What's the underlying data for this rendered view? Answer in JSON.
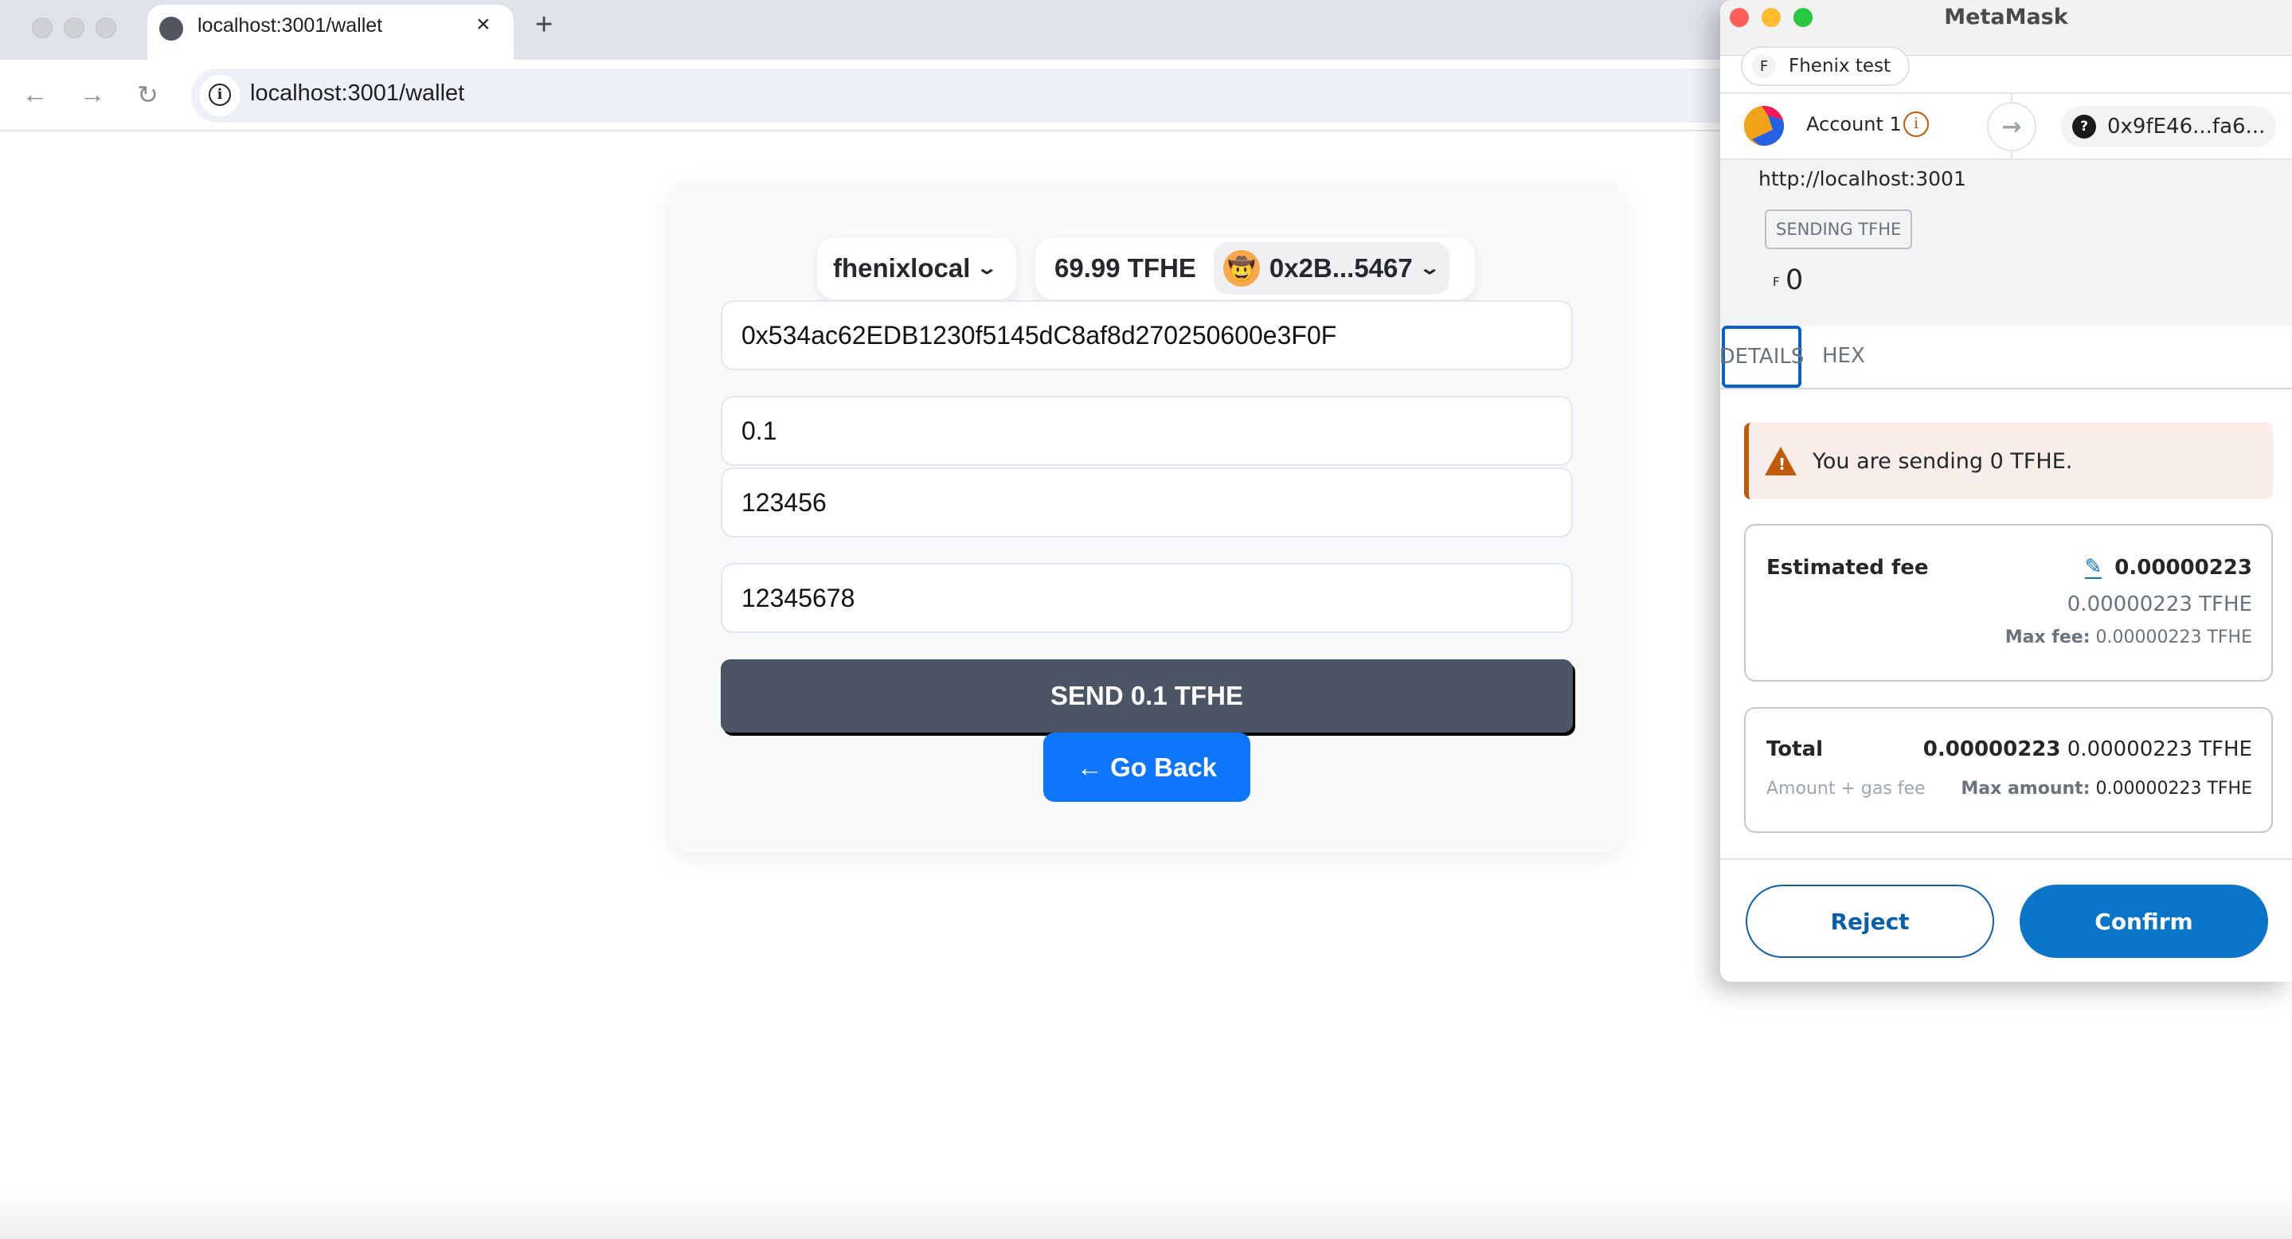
{
  "browser": {
    "tab_title": "localhost:3001/wallet",
    "tab_close_icon": "close-icon",
    "new_tab_icon": "plus-icon",
    "address_bar_url": "localhost:3001/wallet",
    "nav": {
      "back_icon": "←",
      "forward_icon": "→",
      "reload_icon": "↻"
    }
  },
  "wallet": {
    "network": {
      "label": "fhenixlocal",
      "chevron": "⌄"
    },
    "balance": "69.99 TFHE",
    "account": {
      "emoji": "🤠",
      "address": "0x2B...5467",
      "chevron": "⌄"
    },
    "fields": {
      "recipient": "0x534ac62EDB1230f5145dC8af8d270250600e3F0F",
      "amount": "0.1",
      "field_2": "123456",
      "field_3": "12345678"
    },
    "send_button": "SEND 0.1 TFHE",
    "back_button": "← Go Back"
  },
  "metamask": {
    "window_title": "MetaMask",
    "network_pill": {
      "initial": "F",
      "label": "Fhenix test"
    },
    "from_account": {
      "name": "Account 1",
      "info_icon": "i"
    },
    "arrow_icon": "→",
    "recipient": {
      "icon": "?",
      "address": "0x9fE46...fa6..."
    },
    "origin": "http://localhost:3001",
    "badge": "SENDING TFHE",
    "amount": {
      "symbol": "F",
      "value": "0"
    },
    "tabs": [
      {
        "label": "DETAILS",
        "active": true
      },
      {
        "label": "HEX",
        "active": false
      }
    ],
    "alert": {
      "text": "You are sending 0 TFHE.",
      "icon": "!"
    },
    "estimated_fee": {
      "label": "Estimated fee",
      "value_bold": "0.00000223",
      "value_full": "0.00000223 TFHE",
      "max_fee_label": "Max fee:",
      "max_fee_value": "0.00000223 TFHE"
    },
    "total": {
      "label": "Total",
      "value_bold": "0.00000223",
      "value_full": "0.00000223 TFHE",
      "sublabel": "Amount + gas fee",
      "max_amount_label": "Max amount:",
      "max_amount_value": "0.00000223 TFHE"
    },
    "reject_button": "Reject",
    "confirm_button": "Confirm"
  },
  "colors": {
    "send_button_bg": "#4b5565",
    "back_button_bg": "#0d76fc",
    "metamask_primary": "#0a74c9",
    "warning": "#c05b0c"
  }
}
